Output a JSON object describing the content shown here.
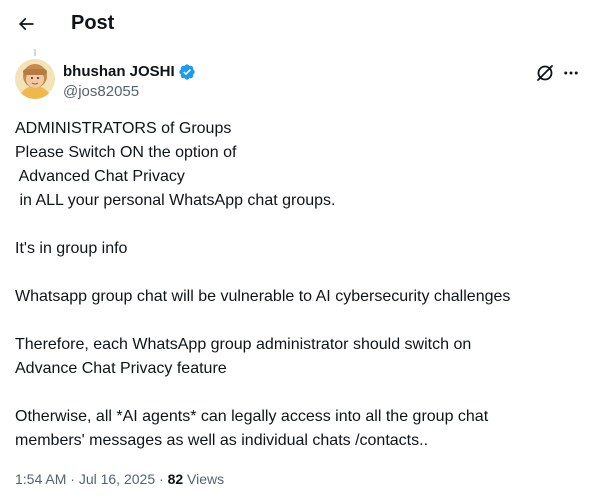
{
  "header": {
    "title": "Post"
  },
  "author": {
    "display_name": "bhushan JOSHI",
    "handle": "@jos82055"
  },
  "post": {
    "paragraphs": [
      [
        "ADMINISTRATORS of Groups",
        "Please Switch ON the option of",
        " Advanced Chat Privacy",
        " in ALL your personal WhatsApp chat groups."
      ],
      [
        "It's in group info"
      ],
      [
        "Whatsapp group chat will be vulnerable to AI cybersecurity challenges"
      ],
      [
        "Therefore, each WhatsApp group administrator should switch on",
        "Advance Chat Privacy feature"
      ],
      [
        "Otherwise, all *AI agents* can legally access into all the group chat",
        "members' messages as well as individual chats /contacts.."
      ]
    ],
    "time": "1:54 AM",
    "date": "Jul 16, 2025",
    "separator": "·",
    "views_count": "82",
    "views_label": "Views"
  },
  "colors": {
    "text": "#0f1419",
    "secondary": "#536471",
    "verified": "#1d9bf0"
  },
  "icons": [
    "back-arrow-icon",
    "verified-badge-icon",
    "grok-icon",
    "more-icon"
  ]
}
